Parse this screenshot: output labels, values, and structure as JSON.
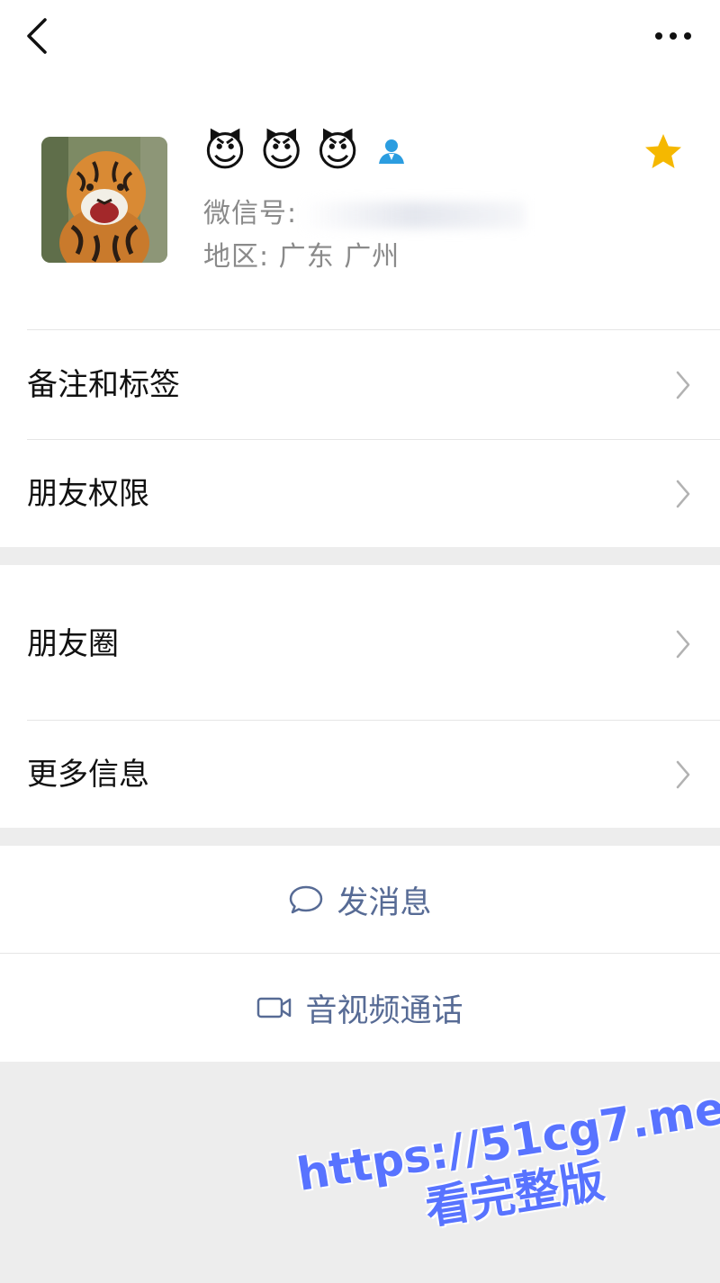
{
  "navbar": {
    "back_icon": "chevron-left-icon",
    "more_icon": "ellipsis-icon"
  },
  "profile": {
    "avatar": "tiger-photo",
    "name": "😈 😈 😈",
    "contact_type_icon": "person-icon",
    "star_icon": "star-icon",
    "star_color": "#f5b800",
    "wechat_id_label": "微信号:",
    "region_label": "地区:",
    "region_value": "广东 广州"
  },
  "menu_group_1": {
    "items": [
      {
        "label": "备注和标签"
      },
      {
        "label": "朋友权限"
      }
    ]
  },
  "menu_group_2": {
    "items": [
      {
        "label": "朋友圈"
      },
      {
        "label": "更多信息"
      }
    ]
  },
  "actions": {
    "message_label": "发消息",
    "message_icon": "chat-bubble-icon",
    "call_label": "音视频通话",
    "call_icon": "video-camera-icon",
    "link_color": "#576b95"
  },
  "watermark": {
    "line1": "https://51cg7.me",
    "line2": "看完整版",
    "color": "#5873ff"
  }
}
